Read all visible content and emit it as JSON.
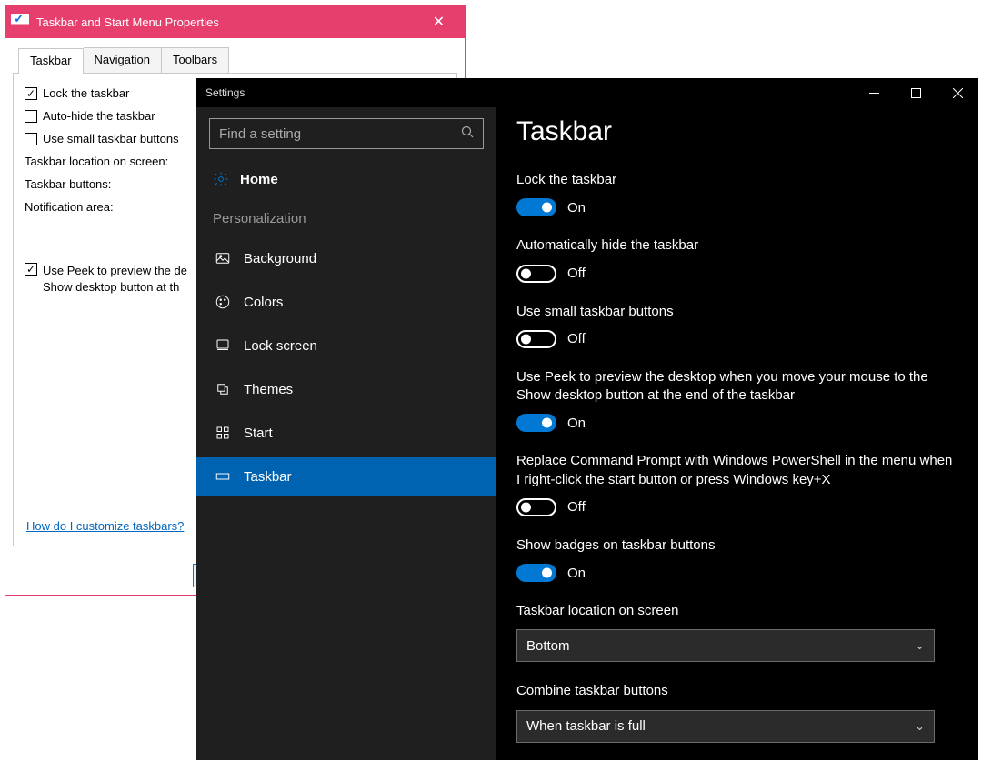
{
  "legacy": {
    "title": "Taskbar and Start Menu Properties",
    "tabs": [
      "Taskbar",
      "Navigation",
      "Toolbars"
    ],
    "checks": [
      {
        "label": "Lock the taskbar",
        "checked": true
      },
      {
        "label": "Auto-hide the taskbar",
        "checked": false
      },
      {
        "label": "Use small taskbar buttons",
        "checked": false
      }
    ],
    "staticLabels": [
      "Taskbar location on screen:",
      "Taskbar buttons:",
      "Notification area:"
    ],
    "peek": {
      "checked": true,
      "line1": "Use Peek to preview the de",
      "line2": "Show desktop button at th"
    },
    "helpLink": "How do I customize taskbars?"
  },
  "settings": {
    "windowTitle": "Settings",
    "searchPlaceholder": "Find a setting",
    "home": "Home",
    "section": "Personalization",
    "nav": [
      {
        "key": "background",
        "label": "Background"
      },
      {
        "key": "colors",
        "label": "Colors"
      },
      {
        "key": "lockscreen",
        "label": "Lock screen"
      },
      {
        "key": "themes",
        "label": "Themes"
      },
      {
        "key": "start",
        "label": "Start"
      },
      {
        "key": "taskbar",
        "label": "Taskbar",
        "selected": true
      }
    ],
    "page": {
      "title": "Taskbar",
      "toggles": [
        {
          "label": "Lock the taskbar",
          "state": "On",
          "on": true
        },
        {
          "label": "Automatically hide the taskbar",
          "state": "Off",
          "on": false
        },
        {
          "label": "Use small taskbar buttons",
          "state": "Off",
          "on": false
        },
        {
          "label": "Use Peek to preview the desktop when you move your mouse to the Show desktop button at the end of the taskbar",
          "state": "On",
          "on": true
        },
        {
          "label": "Replace Command Prompt with Windows PowerShell in the menu when I right-click the start button or press Windows key+X",
          "state": "Off",
          "on": false
        },
        {
          "label": "Show badges on taskbar buttons",
          "state": "On",
          "on": true
        }
      ],
      "dropdowns": [
        {
          "label": "Taskbar location on screen",
          "value": "Bottom"
        },
        {
          "label": "Combine taskbar buttons",
          "value": "When taskbar is full"
        }
      ]
    }
  }
}
